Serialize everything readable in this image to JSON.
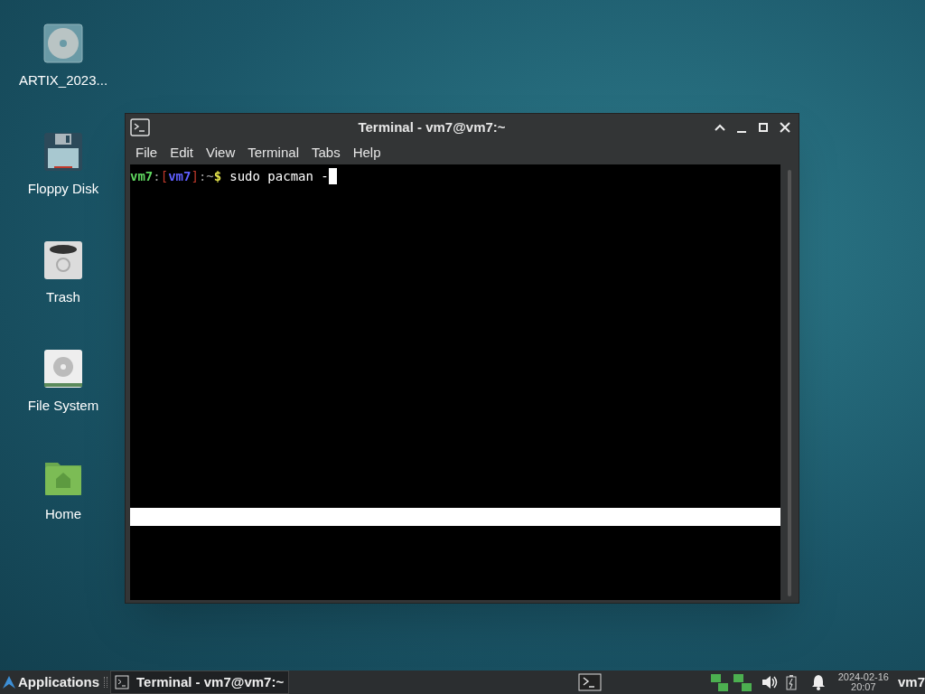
{
  "desktop_icons": [
    {
      "kind": "disc",
      "label": "ARTIX_2023..."
    },
    {
      "kind": "floppy",
      "label": "Floppy Disk"
    },
    {
      "kind": "trash",
      "label": "Trash"
    },
    {
      "kind": "drive",
      "label": "File System"
    },
    {
      "kind": "home",
      "label": "Home"
    }
  ],
  "window": {
    "title": "Terminal - vm7@vm7:~",
    "menu": [
      "File",
      "Edit",
      "View",
      "Terminal",
      "Tabs",
      "Help"
    ],
    "prompt": [
      {
        "text": "vm7",
        "color": "#5fd75f"
      },
      {
        "text": ":",
        "color": "#9a9a9a"
      },
      {
        "text": "[",
        "color": "#c0392b"
      },
      {
        "text": "vm7",
        "color": "#5f5fff"
      },
      {
        "text": "]",
        "color": "#c0392b"
      },
      {
        "text": ":~",
        "color": "#9a9a9a"
      },
      {
        "text": "$",
        "color": "#e5e54c"
      }
    ],
    "command": "sudo pacman -"
  },
  "taskbar": {
    "menu": "Applications",
    "tasks": [
      {
        "label": "Terminal - vm7@vm7:~",
        "selected": true
      }
    ],
    "date": "2024-02-16",
    "time": "20:07",
    "user": "vm7"
  }
}
